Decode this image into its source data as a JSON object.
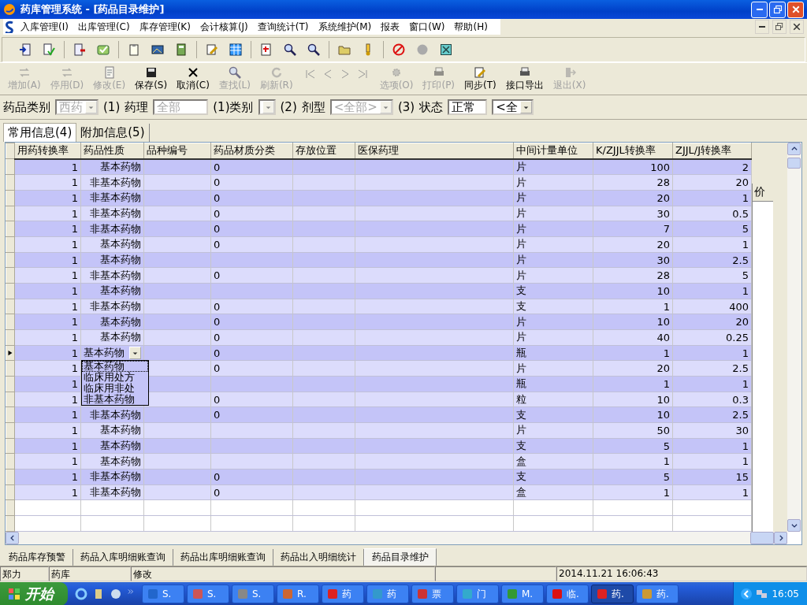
{
  "window": {
    "title": "药库管理系统 - [药品目录维护]"
  },
  "menu": [
    "入库管理(I)",
    "出库管理(C)",
    "库存管理(K)",
    "会计核算(J)",
    "查询统计(T)",
    "系统维护(M)",
    "报表",
    "窗口(W)",
    "帮助(H)"
  ],
  "toolbar_buttons": [
    {
      "label": "增加(A)",
      "disabled": true
    },
    {
      "label": "停用(D)",
      "disabled": true
    },
    {
      "label": "修改(E)",
      "disabled": true
    },
    {
      "label": "保存(S)",
      "disabled": false
    },
    {
      "label": "取消(C)",
      "disabled": false
    },
    {
      "label": "查找(L)",
      "disabled": true
    },
    {
      "label": "刷新(R)",
      "disabled": true
    },
    {
      "label": "选项(O)",
      "disabled": true
    },
    {
      "label": "打印(P)",
      "disabled": true
    },
    {
      "label": "同步(T)",
      "disabled": false
    },
    {
      "label": "接口导出",
      "disabled": false
    },
    {
      "label": "退出(X)",
      "disabled": true
    }
  ],
  "filters": [
    {
      "kind": "label",
      "text": "药品类别"
    },
    {
      "kind": "combo",
      "value": "西药",
      "disabled": true
    },
    {
      "kind": "label",
      "text": "(1)"
    },
    {
      "kind": "label",
      "text": "药理"
    },
    {
      "kind": "field",
      "value": "全部",
      "disabled": true
    },
    {
      "kind": "label",
      "text": "(1)类别"
    },
    {
      "kind": "combo",
      "disabled": true
    },
    {
      "kind": "label",
      "text": "(2)"
    },
    {
      "kind": "label",
      "text": "剂型"
    },
    {
      "kind": "combo",
      "value": "<全部>",
      "disabled": true
    },
    {
      "kind": "label",
      "text": "(3)"
    },
    {
      "kind": "label",
      "text": "状态"
    },
    {
      "kind": "field",
      "value": "正常",
      "disabled": false
    },
    {
      "kind": "combo",
      "value": "<全",
      "disabled": false
    }
  ],
  "tabs": [
    {
      "label": "常用信息(4)",
      "selected": true
    },
    {
      "label": "附加信息(5)",
      "selected": false
    }
  ],
  "grid": {
    "columns": [
      "用药转换率",
      "药品性质",
      "品种编号",
      "药品材质分类",
      "存放位置",
      "医保药理",
      "中间计量单位",
      "K/ZJJL转换率",
      "ZJJL/J转换率"
    ],
    "rows": [
      {
        "rate": "1",
        "nature": "基本药物",
        "material": "0",
        "unit": "片",
        "k_rate": "100",
        "j_rate": "2",
        "current": false
      },
      {
        "rate": "1",
        "nature": "非基本药物",
        "material": "0",
        "unit": "片",
        "k_rate": "28",
        "j_rate": "20",
        "current": false
      },
      {
        "rate": "1",
        "nature": "非基本药物",
        "material": "0",
        "unit": "片",
        "k_rate": "20",
        "j_rate": "1",
        "current": false
      },
      {
        "rate": "1",
        "nature": "非基本药物",
        "material": "0",
        "unit": "片",
        "k_rate": "30",
        "j_rate": "0.5",
        "current": false
      },
      {
        "rate": "1",
        "nature": "非基本药物",
        "material": "0",
        "unit": "片",
        "k_rate": "7",
        "j_rate": "5",
        "current": false
      },
      {
        "rate": "1",
        "nature": "基本药物",
        "material": "0",
        "unit": "片",
        "k_rate": "20",
        "j_rate": "1",
        "current": false
      },
      {
        "rate": "1",
        "nature": "基本药物",
        "unit": "片",
        "k_rate": "30",
        "j_rate": "2.5",
        "current": false
      },
      {
        "rate": "1",
        "nature": "非基本药物",
        "material": "0",
        "unit": "片",
        "k_rate": "28",
        "j_rate": "5",
        "current": false
      },
      {
        "rate": "1",
        "nature": "基本药物",
        "unit": "支",
        "k_rate": "10",
        "j_rate": "1",
        "current": false
      },
      {
        "rate": "1",
        "nature": "非基本药物",
        "material": "0",
        "unit": "支",
        "k_rate": "1",
        "j_rate": "400",
        "current": false
      },
      {
        "rate": "1",
        "nature": "基本药物",
        "material": "0",
        "unit": "片",
        "k_rate": "10",
        "j_rate": "20",
        "current": false
      },
      {
        "rate": "1",
        "nature": "基本药物",
        "material": "0",
        "unit": "片",
        "k_rate": "40",
        "j_rate": "0.25",
        "current": false
      },
      {
        "rate": "1",
        "nature": "基本药物",
        "material": "0",
        "unit": "瓶",
        "k_rate": "1",
        "j_rate": "1",
        "current": true
      },
      {
        "rate": "1",
        "material": "0",
        "unit": "片",
        "k_rate": "20",
        "j_rate": "2.5",
        "current": false
      },
      {
        "rate": "1",
        "unit": "瓶",
        "k_rate": "1",
        "j_rate": "1",
        "current": false
      },
      {
        "rate": "1",
        "material": "0",
        "unit": "粒",
        "k_rate": "10",
        "j_rate": "0.3",
        "current": false
      },
      {
        "rate": "1",
        "nature": "非基本药物",
        "material": "0",
        "unit": "支",
        "k_rate": "10",
        "j_rate": "2.5",
        "current": false
      },
      {
        "rate": "1",
        "nature": "基本药物",
        "unit": "片",
        "k_rate": "50",
        "j_rate": "30",
        "current": false
      },
      {
        "rate": "1",
        "nature": "基本药物",
        "unit": "支",
        "k_rate": "5",
        "j_rate": "1",
        "current": false
      },
      {
        "rate": "1",
        "nature": "基本药物",
        "unit": "盒",
        "k_rate": "1",
        "j_rate": "1",
        "current": false
      },
      {
        "rate": "1",
        "nature": "非基本药物",
        "material": "0",
        "unit": "支",
        "k_rate": "5",
        "j_rate": "15",
        "current": false
      },
      {
        "rate": "1",
        "nature": "非基本药物",
        "material": "0",
        "unit": "盒",
        "k_rate": "1",
        "j_rate": "1",
        "current": false
      }
    ],
    "dropdown": {
      "options": [
        {
          "label": "基本药物",
          "selected": true
        },
        {
          "label": "临床用处方",
          "selected": false
        },
        {
          "label": "临床用非处",
          "selected": false
        },
        {
          "label": "非基本药物",
          "selected": false
        }
      ]
    }
  },
  "side_panel": {
    "column_header": "价"
  },
  "bottom_tabs": [
    {
      "label": "药品库存预警",
      "selected": false
    },
    {
      "label": "药品入库明细账查询",
      "selected": false
    },
    {
      "label": "药品出库明细账查询",
      "selected": false
    },
    {
      "label": "药品出入明细统计",
      "selected": false
    },
    {
      "label": "药品目录维护",
      "selected": true
    }
  ],
  "status_bar": {
    "user": "郑力",
    "location": "药库",
    "mode": "修改",
    "datetime": "2014.11.21 16:06:43"
  },
  "taskbar": {
    "start": "开始",
    "tasks": [
      {
        "label": "S.",
        "active": false
      },
      {
        "label": "S.",
        "active": false
      },
      {
        "label": "S.",
        "active": false
      },
      {
        "label": "R.",
        "active": false
      },
      {
        "label": "药",
        "active": false
      },
      {
        "label": "药",
        "active": false
      },
      {
        "label": "票",
        "active": false
      },
      {
        "label": "门",
        "active": false
      },
      {
        "label": "M.",
        "active": false
      },
      {
        "label": "临.",
        "active": false
      },
      {
        "label": "药.",
        "active": true
      },
      {
        "label": "药.",
        "active": false
      }
    ],
    "clock": "16:05"
  }
}
